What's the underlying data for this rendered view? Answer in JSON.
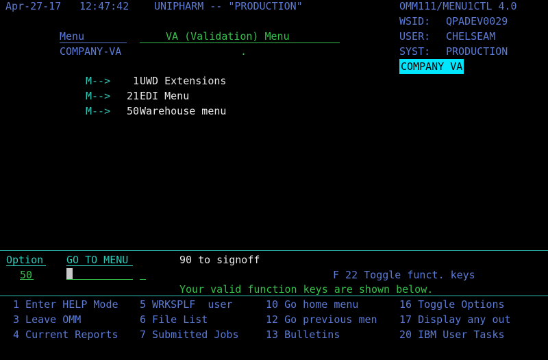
{
  "header": {
    "date": "Apr-27-17",
    "time": "12:47:42",
    "system": "UNIPHARM -- \"PRODUCTION\"",
    "program": "OMM111/MENU1CTL 4.0",
    "wsid_label": "WSID:",
    "wsid_value": "QPADEV0029",
    "user_label": "USER:",
    "user_value": "CHELSEAM",
    "syst_label": "SYST:",
    "syst_value": "PRODUCTION",
    "company_badge": "COMPANY VA"
  },
  "menu": {
    "menu_label": "Menu",
    "menu_name": "COMPANY-VA",
    "title": "VA (Validation) Menu",
    "dot": ".",
    "items": [
      {
        "arrow": "M-->",
        "number": "1",
        "label": "UWD Extensions"
      },
      {
        "arrow": "M-->",
        "number": "21",
        "label": "EDI Menu"
      },
      {
        "arrow": "M-->",
        "number": "50",
        "label": "Warehouse menu"
      }
    ]
  },
  "command": {
    "option_label": "Option",
    "option_value": "50",
    "goto_label": "GO TO MENU",
    "signoff_hint": "90 to signoff",
    "toggle_keys": "F 22 Toggle funct. keys",
    "valid_keys_msg": "Your valid function keys are shown below."
  },
  "function_keys": [
    [
      "1 Enter HELP Mode",
      "5 WRKSPLF  user",
      "10 Go home menu",
      "16 Toggle Options"
    ],
    [
      "3 Leave OMM",
      "6 File List",
      "12 Go previous men",
      "17 Display any out"
    ],
    [
      "4 Current Reports",
      "7 Submitted Jobs",
      "13 Bulletins",
      "20 IBM User Tasks"
    ]
  ],
  "colors": {
    "background": "#000000",
    "label_blue": "#5b7bd6",
    "field_green": "#35c24a",
    "text_white": "#e8e8e8",
    "turquoise": "#2fc7b6",
    "highlight_cyan": "#00e6ff"
  }
}
